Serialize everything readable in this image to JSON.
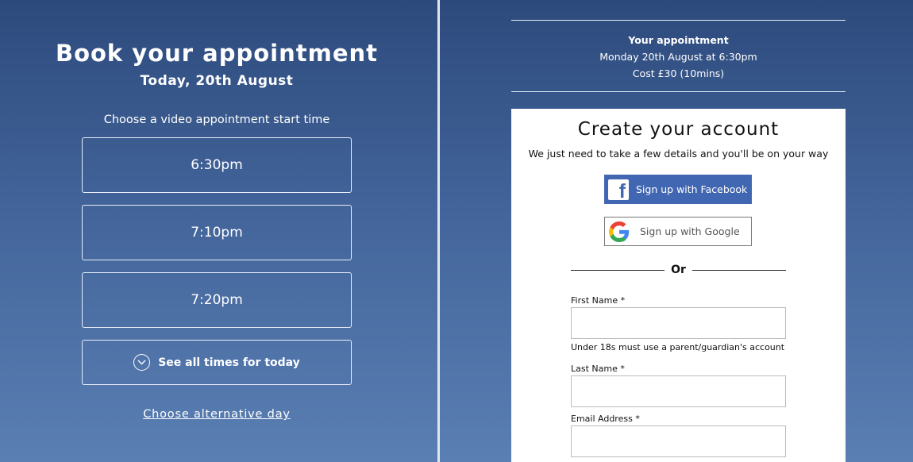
{
  "booking": {
    "title": "Book your appointment",
    "date": "Today, 20th August",
    "prompt": "Choose a video appointment start time",
    "slots": [
      "6:30pm",
      "7:10pm",
      "7:20pm"
    ],
    "see_all": "See all times for today",
    "alternative_day": "Choose alternative day"
  },
  "appointment": {
    "heading": "Your appointment",
    "when": "Monday 20th August at 6:30pm",
    "cost": "Cost £30 (10mins)"
  },
  "account": {
    "title": "Create your account",
    "subtitle": "We just need to take a few details and you'll be on your way",
    "facebook_label": "Sign up with Facebook",
    "google_label": "Sign up with Google",
    "or": "Or",
    "first_name_label": "First Name *",
    "first_name_value": "",
    "under18_hint": "Under 18s must use a parent/guardian's account",
    "last_name_label": "Last Name *",
    "last_name_value": "",
    "email_label": "Email Address *",
    "email_value": ""
  },
  "colors": {
    "background_top": "#2d4a7c",
    "background_bottom": "#5a7fb3",
    "facebook": "#4267b2",
    "card": "#ffffff"
  }
}
